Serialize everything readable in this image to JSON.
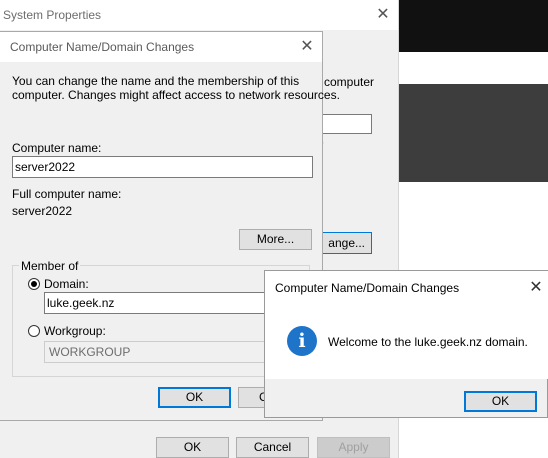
{
  "colors": {
    "accent": "#0078d7",
    "info_icon": "#1e74c9",
    "dialog_bg": "#f0f0f0"
  },
  "system_properties": {
    "title": "System Properties",
    "close_icon": "close-icon",
    "fragments": {
      "computer": "computer",
      "arrow": "r",
      "change_suffix": "ange..."
    },
    "buttons": {
      "ok": "OK",
      "cancel": "Cancel",
      "apply": "Apply"
    }
  },
  "domain_dialog": {
    "title": "Computer Name/Domain Changes",
    "description_line1": "You can change the name and the membership of this",
    "description_line2": "computer. Changes might affect access to network resources.",
    "computer_name_label": "Computer name:",
    "computer_name_value": "server2022",
    "full_name_label": "Full computer name:",
    "full_name_value": "server2022",
    "more_button": "More...",
    "member_of_label": "Member of",
    "domain_label": "Domain:",
    "domain_value": "luke.geek.nz",
    "domain_selected": true,
    "workgroup_label": "Workgroup:",
    "workgroup_value": "WORKGROUP",
    "ok_button": "OK",
    "cancel_button_partial": "C"
  },
  "message_box": {
    "title": "Computer Name/Domain Changes",
    "icon": "info-icon",
    "message": "Welcome to the luke.geek.nz domain.",
    "ok_button": "OK"
  }
}
